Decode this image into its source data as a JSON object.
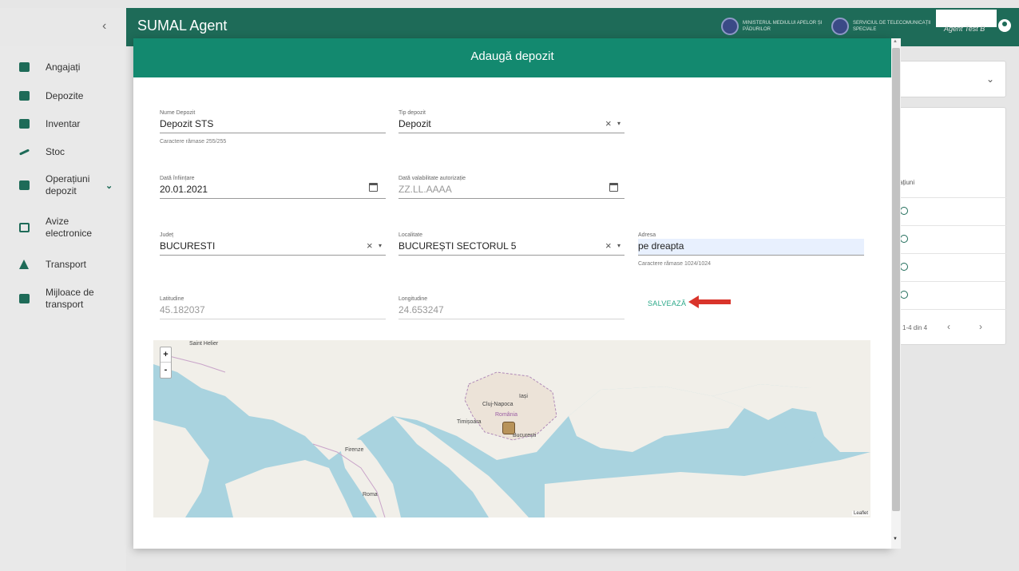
{
  "app": {
    "title": "SUMAL Agent",
    "collapse_icon": "‹",
    "ministries": [
      "MINISTERUL MEDIULUI APELOR ȘI PĂDURILOR",
      "SERVICIUL DE TELECOMUNICAȚII SPECIALE"
    ],
    "user_name": "Agent Test B",
    "brand_color": "#1e6b58"
  },
  "sidebar": {
    "items": [
      {
        "label": "Angajați",
        "icon": "briefcase-icon"
      },
      {
        "label": "Depozite",
        "icon": "warehouse-icon"
      },
      {
        "label": "Inventar",
        "icon": "inventory-icon"
      },
      {
        "label": "Stoc",
        "icon": "trending-icon"
      },
      {
        "label": "Operațiuni depozit",
        "icon": "list-icon",
        "expandable": true
      },
      {
        "label": "Avize electronice",
        "icon": "document-icon"
      },
      {
        "label": "Transport",
        "icon": "transport-icon"
      },
      {
        "label": "Mijloace de transport",
        "icon": "car-icon"
      }
    ]
  },
  "background": {
    "column_header": "ațiuni",
    "pager_text": "1-4 din 4",
    "pager_prev": "‹",
    "pager_next": "›",
    "dropdown_chevron": "⌄"
  },
  "modal": {
    "title": "Adaugă depozit",
    "header_color": "#13896f",
    "fields": {
      "nume_depozit": {
        "label": "Nume Depozit",
        "value": "Depozit STS",
        "hint": "Caractere rămase 255/255"
      },
      "tip_depozit": {
        "label": "Tip depozit",
        "value": "Depozit"
      },
      "data_infiintare": {
        "label": "Dată înființare",
        "value": "20.01.2021"
      },
      "data_valabilitate": {
        "label": "Dată valabilitate autorizație",
        "placeholder": "ZZ.LL.AAAA"
      },
      "judet": {
        "label": "Județ",
        "value": "BUCURESTI"
      },
      "localitate": {
        "label": "Localitate",
        "value": "BUCUREȘTI SECTORUL 5"
      },
      "adresa": {
        "label": "Adresa",
        "value": "pe dreapta",
        "hint": "Caractere rămase 1024/1024"
      },
      "latitudine": {
        "label": "Latitudine",
        "value": "45.182037"
      },
      "longitudine": {
        "label": "Longitudine",
        "value": "24.653247"
      }
    },
    "clear_icon": "×",
    "caret_icon": "▾",
    "save_label": "SALVEAZĂ",
    "save_color": "#2aa888"
  },
  "map": {
    "zoom_in": "+",
    "zoom_out": "-",
    "labels": {
      "saint_helier": "Saint Helier",
      "cluj": "Cluj-Napoca",
      "romania": "România",
      "iasi": "Iași",
      "timisoara": "Timișoara",
      "bucuresti": "București",
      "firenze": "Firenze",
      "roma": "Roma"
    },
    "attribution": "Leaflet",
    "sea_color": "#a9d3df",
    "land_color": "#f1efe9"
  }
}
